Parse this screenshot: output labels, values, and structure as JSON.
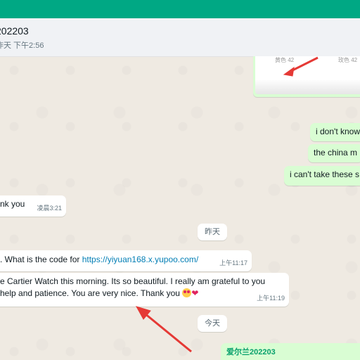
{
  "chat": {
    "name": "202203",
    "status": "昨天 下午2:56"
  },
  "image_message": {
    "caption_left": "黄色 42",
    "caption_right": "玫色 42"
  },
  "messages": {
    "out_1": "i don't know",
    "out_2": "the china m",
    "out_3": "i can't take these s",
    "in_1_text": "nk you",
    "in_1_time": "凌晨3:21",
    "day_1": "昨天",
    "in_2_text": ". What is the code for ",
    "in_2_link": "https://yiyuan168.x.yupoo.com/",
    "in_2_time": "上午11:17",
    "in_3_line1": "e Cartier Watch this morning. Its so beautiful. I really am grateful to you",
    "in_3_line2": "help and patience. You are very nice. Thank you",
    "in_3_time": "上午11:19",
    "day_2": "今天",
    "out_4_sender": "爱尔兰202203"
  },
  "colors": {
    "accent": "#00a884",
    "incoming_bubble": "#ffffff",
    "outgoing_bubble": "#d9fdd3",
    "link": "#027eb5",
    "arrow": "#e53935"
  },
  "icons": {
    "emoji": "heart-eyes-emoji-icon",
    "heart": "red-heart-icon",
    "annotation": "red-arrow-icon"
  }
}
